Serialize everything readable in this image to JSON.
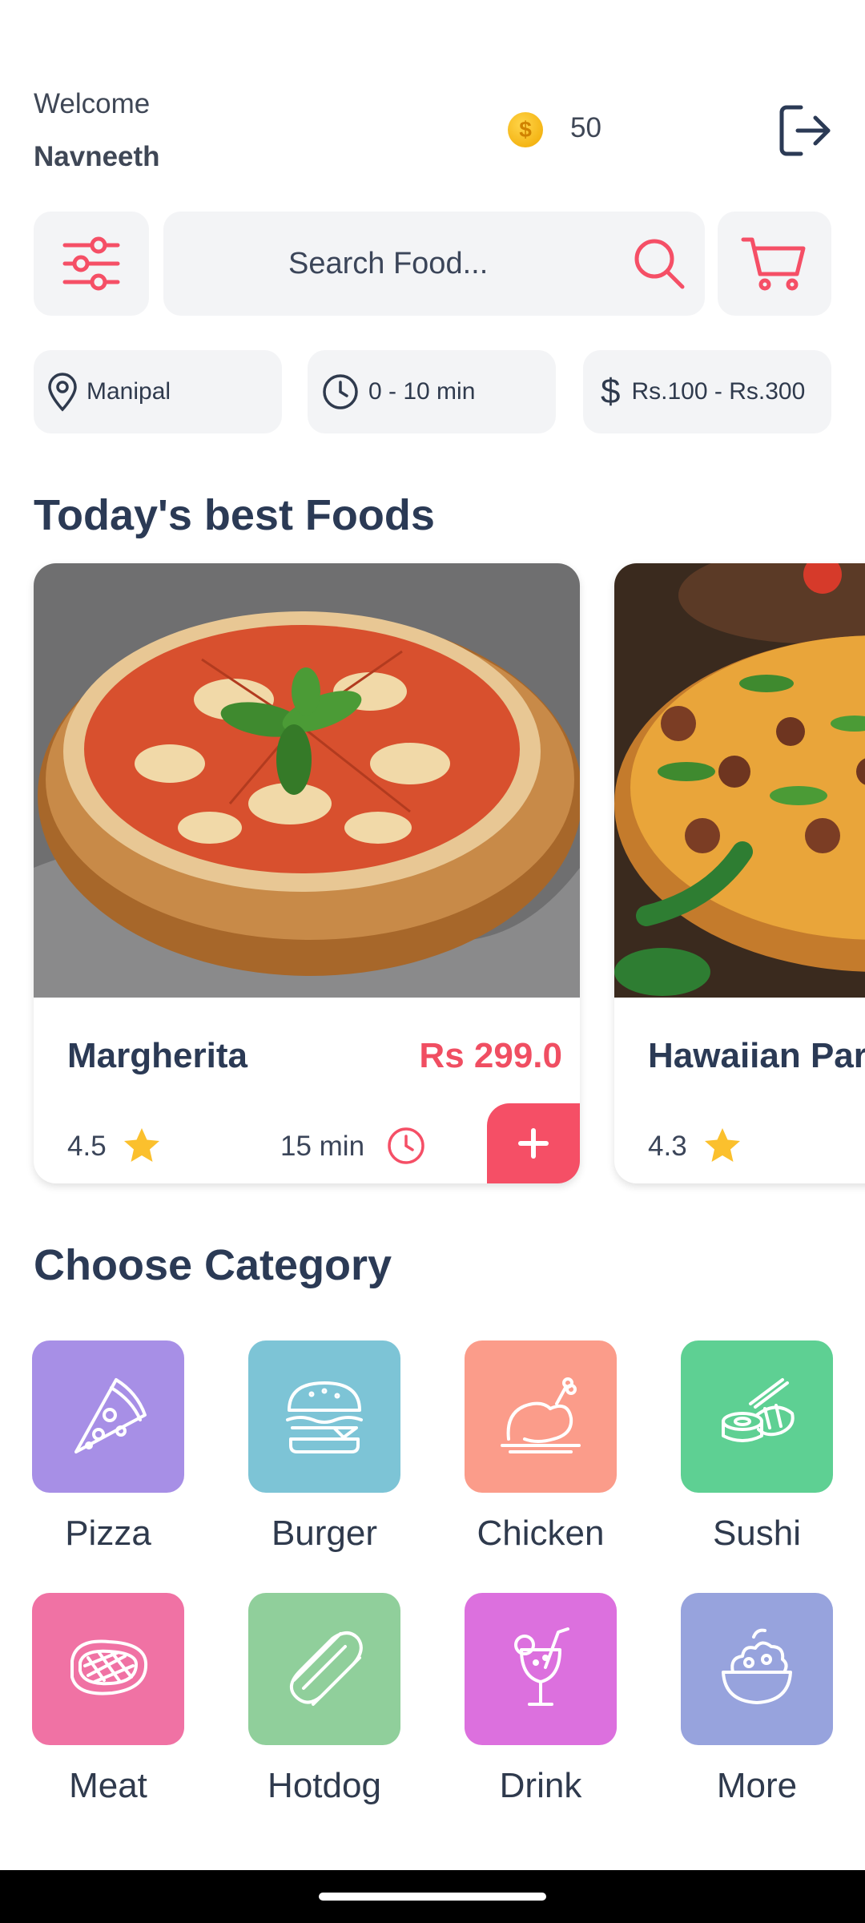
{
  "header": {
    "welcome": "Welcome",
    "user_name": "Navneeth",
    "coins": "50",
    "coin_symbol": "$"
  },
  "search": {
    "placeholder": "Search Food..."
  },
  "filters": {
    "location": "Manipal",
    "time": "0 - 10 min",
    "price_symbol": "$",
    "price": "Rs.100 - Rs.300"
  },
  "best_foods": {
    "title": "Today's best Foods",
    "items": [
      {
        "name": "Margherita",
        "price": "Rs 299.0",
        "rating": "4.5",
        "time": "15 min"
      },
      {
        "name": "Hawaiian Par",
        "rating": "4.3"
      }
    ]
  },
  "categories": {
    "title": "Choose Category",
    "items": [
      {
        "label": "Pizza",
        "color": "#a78fe6",
        "icon": "pizza-icon"
      },
      {
        "label": "Burger",
        "color": "#7dc4d6",
        "icon": "burger-icon"
      },
      {
        "label": "Chicken",
        "color": "#fb9c8a",
        "icon": "chicken-icon"
      },
      {
        "label": "Sushi",
        "color": "#5ed093",
        "icon": "sushi-icon"
      },
      {
        "label": "Meat",
        "color": "#f072a4",
        "icon": "meat-icon"
      },
      {
        "label": "Hotdog",
        "color": "#90cf9b",
        "icon": "hotdog-icon"
      },
      {
        "label": "Drink",
        "color": "#dc70de",
        "icon": "drink-icon"
      },
      {
        "label": "More",
        "color": "#97a3dd",
        "icon": "salad-icon"
      }
    ]
  },
  "colors": {
    "accent": "#f54f66",
    "text_dark": "#2b3a55",
    "tile_bg": "#f3f4f6",
    "star": "#fbc02d"
  }
}
